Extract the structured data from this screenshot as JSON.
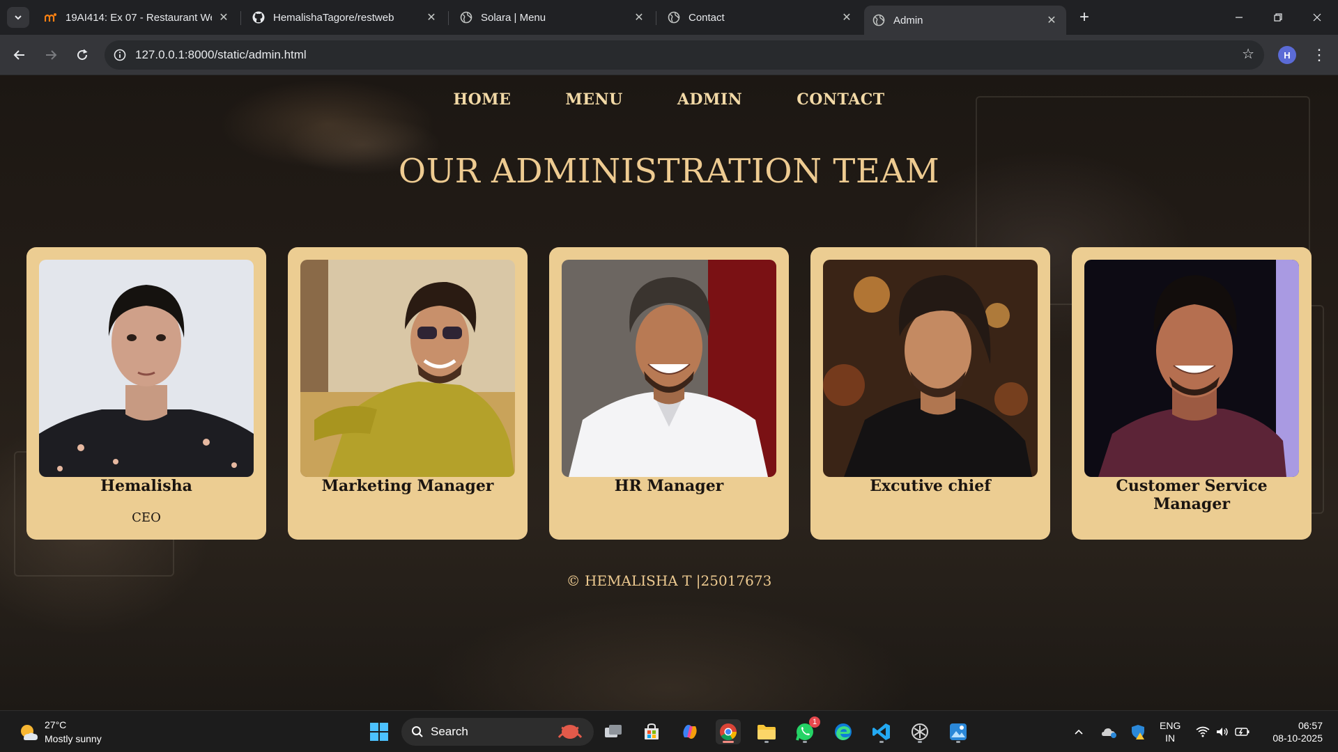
{
  "browser": {
    "tabs": [
      {
        "title": "19AI414: Ex 07 - Restaurant We",
        "icon": "moodle-icon",
        "active": false
      },
      {
        "title": "HemalishaTagore/restweb",
        "icon": "github-icon",
        "active": false
      },
      {
        "title": "Solara | Menu",
        "icon": "globe-icon",
        "active": false
      },
      {
        "title": "Contact",
        "icon": "globe-icon",
        "active": false
      },
      {
        "title": "Admin",
        "icon": "globe-icon",
        "active": true
      }
    ],
    "url": "127.0.0.1:8000/static/admin.html",
    "profile_initial": "H"
  },
  "page": {
    "nav": [
      "HOME",
      "MENU",
      "ADMIN",
      "CONTACT"
    ],
    "heading": "OUR ADMINISTRATION TEAM",
    "team": [
      {
        "name": "Hemalisha",
        "role": "CEO"
      },
      {
        "name": "Marketing Manager",
        "role": ""
      },
      {
        "name": "HR Manager",
        "role": ""
      },
      {
        "name": "Excutive chief",
        "role": ""
      },
      {
        "name": "Customer Service Manager",
        "role": ""
      }
    ],
    "footer": "© HEMALISHA T |25017673",
    "colors": {
      "accent": "#eecb91",
      "card": "#eccd92"
    }
  },
  "taskbar": {
    "weather_temp": "27°C",
    "weather_desc": "Mostly sunny",
    "search_label": "Search",
    "whatsapp_badge": "1",
    "lang_line1": "ENG",
    "lang_line2": "IN",
    "time": "06:57",
    "date": "08-10-2025"
  }
}
